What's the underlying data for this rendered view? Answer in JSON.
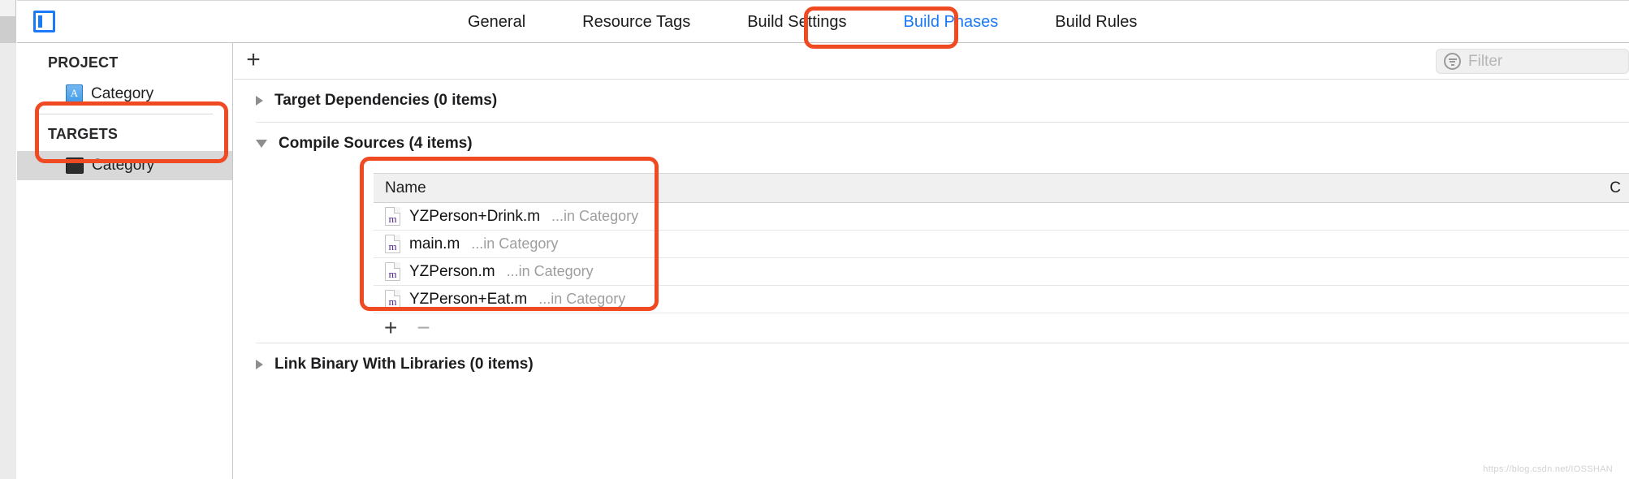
{
  "window": {
    "project_icon": "project-navigator-icon"
  },
  "tabbar": {
    "tabs": [
      {
        "label": "General",
        "active": false
      },
      {
        "label": "Resource Tags",
        "active": false
      },
      {
        "label": "Build Settings",
        "active": false
      },
      {
        "label": "Build Phases",
        "active": true
      },
      {
        "label": "Build Rules",
        "active": false
      }
    ],
    "active_tab": "Build Phases",
    "active_color": "#1a7af8"
  },
  "sidebar": {
    "project_group_label": "PROJECT",
    "project_items": [
      {
        "label": "Category",
        "icon": "xcode-project-icon"
      }
    ],
    "targets_group_label": "TARGETS",
    "target_items": [
      {
        "label": "Category",
        "icon": "app-target-icon",
        "selected": true
      }
    ]
  },
  "toolbar": {
    "add_phase_label": "+",
    "filter": {
      "placeholder": "Filter",
      "value": "",
      "icon": "filter-icon"
    }
  },
  "phases": [
    {
      "title": "Target Dependencies (0 items)",
      "expanded": false,
      "items": []
    },
    {
      "title": "Compile Sources (4 items)",
      "expanded": true,
      "table": {
        "columns": [
          "Name",
          "C"
        ],
        "rows": [
          {
            "icon": "objc-source-file-icon",
            "name": "YZPerson+Drink.m",
            "location": "...in Category"
          },
          {
            "icon": "objc-source-file-icon",
            "name": "main.m",
            "location": "...in Category"
          },
          {
            "icon": "objc-source-file-icon",
            "name": "YZPerson.m",
            "location": "...in Category"
          },
          {
            "icon": "objc-source-file-icon",
            "name": "YZPerson+Eat.m",
            "location": "...in Category"
          }
        ]
      },
      "add_label": "+",
      "remove_label": "−"
    },
    {
      "title": "Link Binary With Libraries (0 items)",
      "expanded": false,
      "items": []
    }
  ],
  "annotations": {
    "color": "#f04a23",
    "boxes": [
      {
        "name": "build-phases-tab-highlight"
      },
      {
        "name": "targets-section-highlight"
      },
      {
        "name": "compile-sources-files-highlight"
      }
    ]
  },
  "watermark": {
    "text": "https://blog.csdn.net/IOSSHAN"
  }
}
